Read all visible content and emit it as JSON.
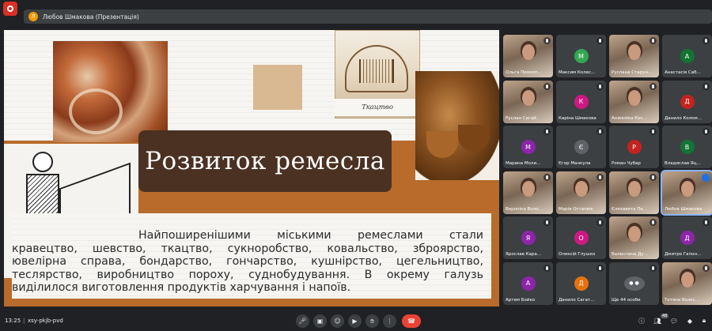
{
  "presenter": {
    "avatar_letter": "Л",
    "label": "Любов Шмакова (Презентація)"
  },
  "slide": {
    "title": "Розвиток ремесла",
    "weave_caption": "Ткацтво",
    "body": "Найпоширенішими міськими ремеслами стали кравецтво, шевство, ткацтво, сукноробство, ковальство, зброярство, ювелірна справа, бондарство, гончарство, кушнірство, цегельництво, теслярство, виробництво пороху, суднобудування. В окрему галузь виділилося виготовлення продуктів харчування і напоїв."
  },
  "participants": [
    {
      "name": "Ольга Прокоп...",
      "type": "video"
    },
    {
      "name": "Максим Колес...",
      "type": "avatar",
      "letter": "М",
      "color": "#33a852"
    },
    {
      "name": "Руслана Старун...",
      "type": "video"
    },
    {
      "name": "Анастасія Саб...",
      "type": "avatar",
      "letter": "А",
      "color": "#137333"
    },
    {
      "name": "Руслан Сагай",
      "type": "video"
    },
    {
      "name": "Каріна Шмакова",
      "type": "avatar",
      "letter": "К",
      "color": "#d01884"
    },
    {
      "name": "Анжеліка Кос...",
      "type": "video"
    },
    {
      "name": "Данило Колом...",
      "type": "avatar",
      "letter": "Д",
      "color": "#c5221f"
    },
    {
      "name": "Марина Моли...",
      "type": "avatar",
      "letter": "М",
      "color": "#8e24aa"
    },
    {
      "name": "Єгор Манкула",
      "type": "avatar",
      "letter": "Є",
      "color": "#5f6368"
    },
    {
      "name": "Роман Чубар",
      "type": "avatar",
      "letter": "Р",
      "color": "#c5221f"
    },
    {
      "name": "Владислав Яц...",
      "type": "avatar",
      "letter": "В",
      "color": "#137333"
    },
    {
      "name": "Вероніка Воло...",
      "type": "video"
    },
    {
      "name": "Марія Остапюк",
      "type": "video"
    },
    {
      "name": "Єлизавета Па...",
      "type": "video"
    },
    {
      "name": "Любов Шмакова",
      "type": "video",
      "active": true
    },
    {
      "name": "Ярослав Кара...",
      "type": "avatar",
      "letter": "Я",
      "color": "#8e24aa"
    },
    {
      "name": "Олексій Глушко",
      "type": "avatar",
      "letter": "О",
      "color": "#d01884"
    },
    {
      "name": "Валентина Ду...",
      "type": "video"
    },
    {
      "name": "Дмитро Гапон...",
      "type": "avatar",
      "letter": "Д",
      "color": "#8e24aa"
    },
    {
      "name": "Артем Бойко",
      "type": "avatar",
      "letter": "А",
      "color": "#8e24aa"
    },
    {
      "name": "Данило Сагат...",
      "type": "avatar",
      "letter": "Д",
      "color": "#e8710a"
    },
    {
      "name": "Ще 44 особи",
      "type": "more"
    },
    {
      "name": "Тетяна Вазис...",
      "type": "video"
    }
  ],
  "bottom": {
    "time": "13:25",
    "separator": "|",
    "meeting_code": "xsy-pkjb-pvd",
    "participant_count": "48"
  }
}
